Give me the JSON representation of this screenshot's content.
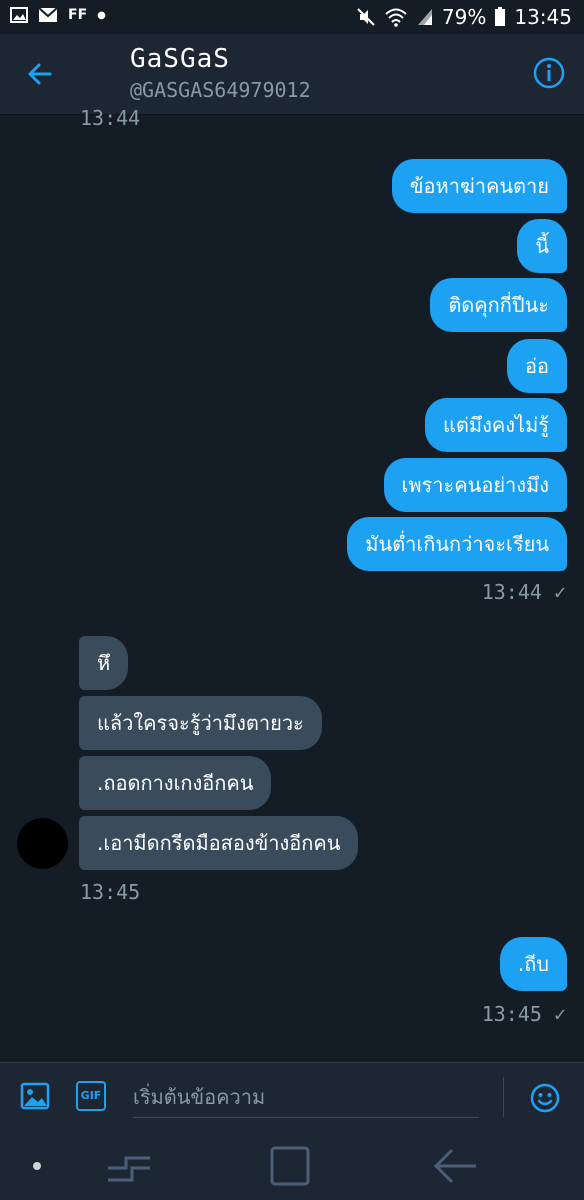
{
  "status_bar": {
    "ff_label": "FF",
    "battery": "79%",
    "time": "13:45"
  },
  "header": {
    "name": "GaSGaS",
    "handle": "@GASGAS64979012"
  },
  "messages": {
    "top_time": "13:44",
    "outgoing1": [
      "ข้อหาฆ่าคนตาย",
      "นี้",
      "ติดคุกกี่ปีนะ",
      "อ่อ",
      "แต่มึงคงไม่รู้",
      "เพราะคนอย่างมึง",
      "มันต่ำเกินกว่าจะเรียน"
    ],
    "out1_time": "13:44 ✓",
    "incoming": [
      "หึ",
      "แล้วใครจะรู้ว่ามึงตายวะ",
      ".ถอดกางเกงอีกคน",
      ".เอามีดกรีดมือสองข้างอีกคน"
    ],
    "in_time": "13:45",
    "outgoing2": ".ถีบ",
    "out2_time": "13:45 ✓"
  },
  "composer": {
    "placeholder": "เริ่มต้นข้อความ",
    "gif_label": "GIF"
  },
  "colors": {
    "accent": "#1da1f2",
    "background": "#141d26",
    "incoming_bubble": "#3a4b5c"
  },
  "icons": [
    "gallery-icon",
    "mail-icon",
    "wifi-icon",
    "signal-icon",
    "battery-icon",
    "mute-icon",
    "back-arrow-icon",
    "info-icon",
    "image-icon",
    "gif-icon",
    "emoji-icon",
    "recent-apps-icon",
    "home-icon",
    "nav-back-icon"
  ]
}
